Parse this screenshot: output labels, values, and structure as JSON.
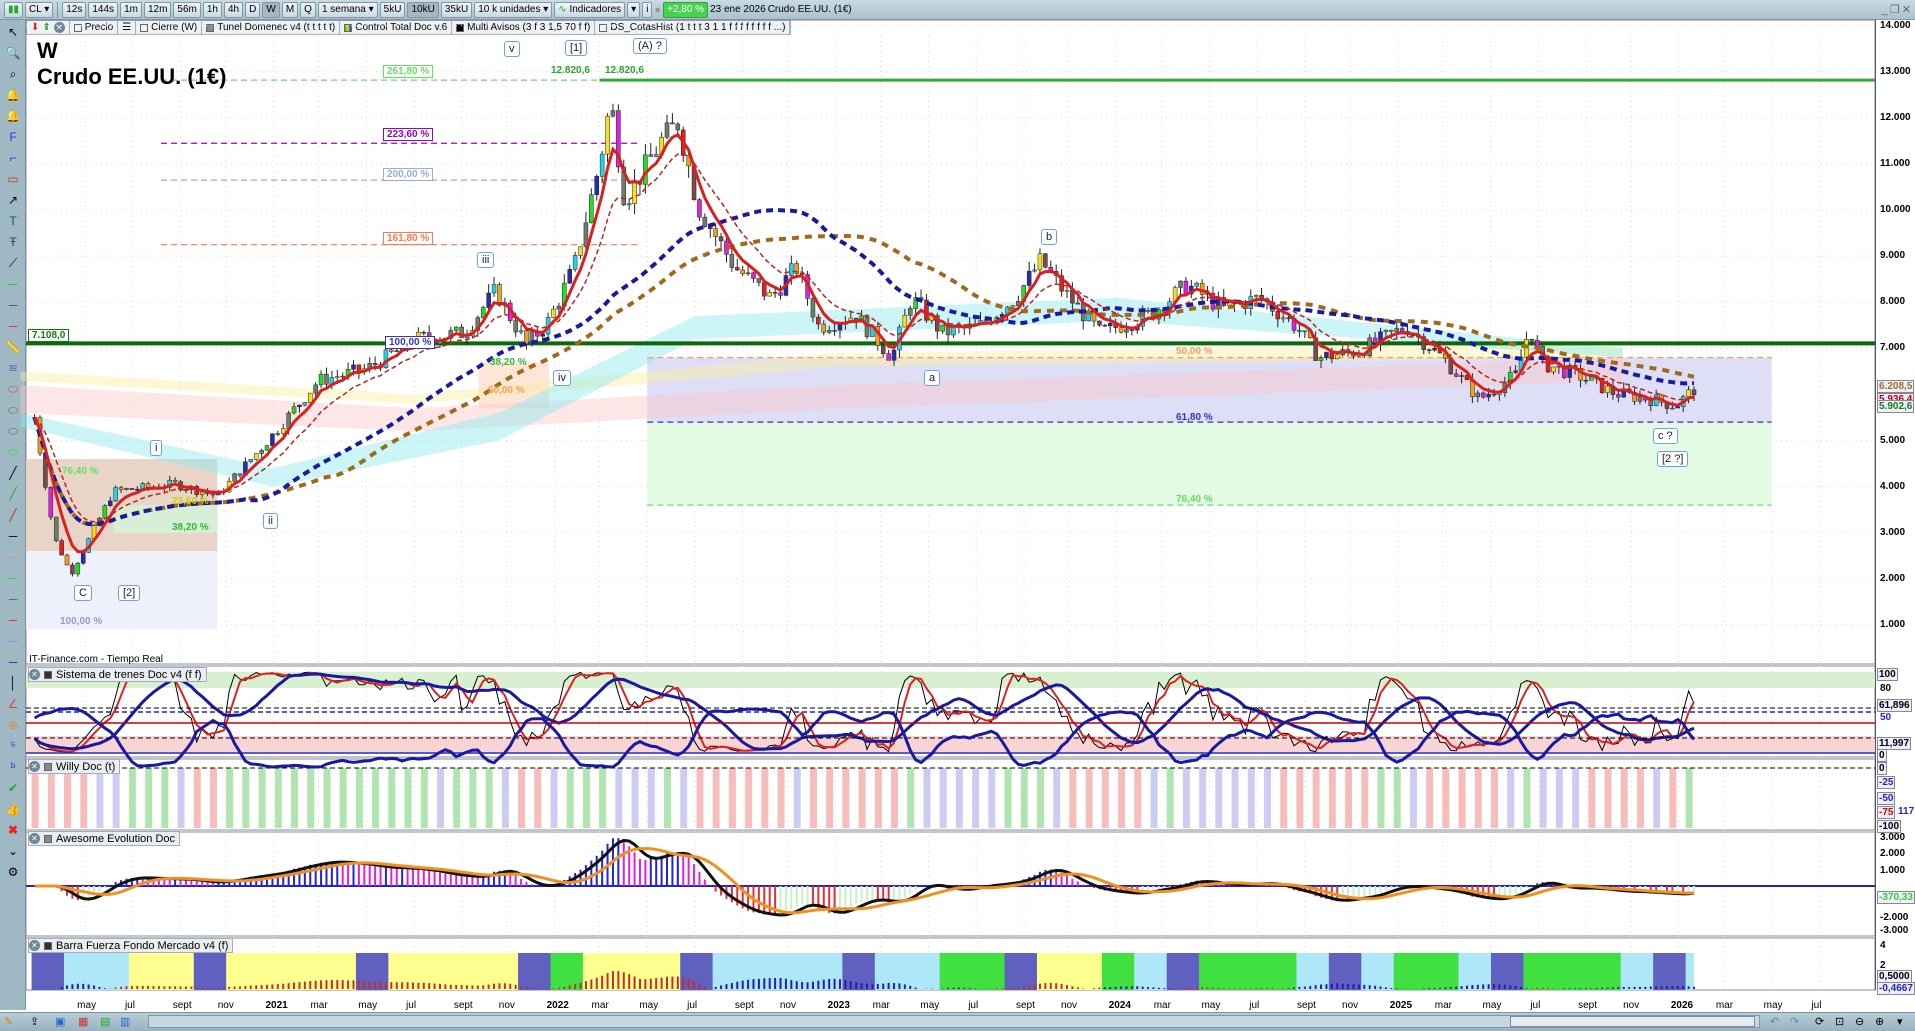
{
  "toolbar": {
    "symbol": "CL",
    "intervals": [
      "12s",
      "144s",
      "1m",
      "12m",
      "56m",
      "1h",
      "4h",
      "D",
      "W",
      "M",
      "Q"
    ],
    "active_interval": "W",
    "period": "1 semana",
    "units": [
      "5kU",
      "10kU",
      "35kU"
    ],
    "active_unit": "10kU",
    "units_select": "10 k unidades",
    "indicators_label": "Indicadores",
    "change": "+2,80 %",
    "date": "23 ene 2026",
    "instrument": "Crudo EE.UU. (1€)"
  },
  "legend": [
    {
      "label": "Precio"
    },
    {
      "label": "Cierre (W)"
    },
    {
      "label": "Tunel Domenec v4 (t t t t t)"
    },
    {
      "label": "Control Total Doc v.6"
    },
    {
      "label": "Multi Avisos (3 f 3 1,5 70 f f)"
    },
    {
      "label": "DS_CotasHist (1 t t t 3 1 1 f f f f f f f f ...)"
    }
  ],
  "chart": {
    "timeframe": "W",
    "title": "Crudo EE.UU. (1€)",
    "source": "IT-Finance.com - Tiempo Real",
    "hline_label": "7.108,0",
    "top_labels": [
      "12.820,6",
      "12.820,6"
    ],
    "price_ticks": [
      "14.000",
      "13.000",
      "12.000",
      "11.000",
      "10.000",
      "9.000",
      "8.000",
      "7.000",
      "5.000",
      "4.000",
      "3.000",
      "2.000",
      "1.000"
    ],
    "price_tick_values": [
      14000,
      13000,
      12000,
      11000,
      10000,
      9000,
      8000,
      7000,
      5000,
      4000,
      3000,
      2000,
      1000
    ],
    "last_labels": [
      {
        "text": "6.208,5",
        "color": "#a0701a"
      },
      {
        "text": "5.936,4",
        "color": "#c00000"
      },
      {
        "text": "5.902,6",
        "color": "#108010"
      }
    ],
    "fib_labels": [
      "261,80 %",
      "223,60 %",
      "200,00 %",
      "161,80 %",
      "100,00 %",
      "38,20 %",
      "50,00 %",
      "76,40 %",
      "23,60 %",
      "38,20 %",
      "100,00 %",
      "50,00 %",
      "61,80 %",
      "76,40 %"
    ],
    "waves": [
      "v",
      "[1]",
      "(A) ?",
      "iii",
      "i",
      "ii",
      "iv",
      "C",
      "[2]",
      "a",
      "b",
      "c ?",
      "[2 ?]"
    ]
  },
  "chart_data": {
    "type": "candlestick",
    "x_unit": "decimal year",
    "y_unit": "price",
    "key_points": [
      [
        2020.15,
        5500
      ],
      [
        2020.22,
        2900
      ],
      [
        2020.28,
        2100
      ],
      [
        2020.43,
        3900
      ],
      [
        2020.65,
        4060
      ],
      [
        2020.8,
        3800
      ],
      [
        2020.98,
        5000
      ],
      [
        2021.16,
        6300
      ],
      [
        2021.33,
        6550
      ],
      [
        2021.51,
        7200
      ],
      [
        2021.68,
        7340
      ],
      [
        2021.79,
        8250
      ],
      [
        2021.9,
        7070
      ],
      [
        2021.98,
        7600
      ],
      [
        2022.07,
        8770
      ],
      [
        2022.16,
        11000
      ],
      [
        2022.2,
        12400
      ],
      [
        2022.25,
        10200
      ],
      [
        2022.38,
        11500
      ],
      [
        2022.44,
        11900
      ],
      [
        2022.51,
        10080
      ],
      [
        2022.64,
        8770
      ],
      [
        2022.77,
        8100
      ],
      [
        2022.86,
        8770
      ],
      [
        2022.94,
        7470
      ],
      [
        2023.07,
        7730
      ],
      [
        2023.2,
        6800
      ],
      [
        2023.27,
        8100
      ],
      [
        2023.38,
        7340
      ],
      [
        2023.51,
        7470
      ],
      [
        2023.64,
        8100
      ],
      [
        2023.73,
        8900
      ],
      [
        2023.81,
        8250
      ],
      [
        2023.94,
        7340
      ],
      [
        2024.12,
        7730
      ],
      [
        2024.25,
        8380
      ],
      [
        2024.38,
        7860
      ],
      [
        2024.51,
        8100
      ],
      [
        2024.64,
        7470
      ],
      [
        2024.72,
        6800
      ],
      [
        2024.86,
        6940
      ],
      [
        2025.03,
        7470
      ],
      [
        2025.16,
        6800
      ],
      [
        2025.29,
        5900
      ],
      [
        2025.42,
        6420
      ],
      [
        2025.47,
        7470
      ],
      [
        2025.51,
        6680
      ],
      [
        2025.64,
        6420
      ],
      [
        2025.77,
        6030
      ],
      [
        2025.9,
        5900
      ],
      [
        2025.99,
        5760
      ],
      [
        2026.06,
        6150
      ]
    ],
    "ylim": [
      0,
      14000
    ],
    "xlim": [
      2020.1,
      2026.6
    ],
    "levels": {
      "resistance": 7108.0,
      "high": 12820.6
    }
  },
  "panels": [
    {
      "title": "Sistema de trenes Doc v4 (f f)",
      "ticks": [
        "100",
        "80",
        "61,896",
        "50",
        "11,997",
        "0"
      ]
    },
    {
      "title": "Willy Doc (t)",
      "ticks": [
        "0",
        "-25",
        "-50",
        "-75",
        "-100"
      ],
      "value": "117"
    },
    {
      "title": "Awesome Evolution Doc",
      "ticks": [
        "3.000",
        "2.000",
        "1.000",
        "-370,33",
        "-2.000",
        "-3.000"
      ]
    },
    {
      "title": "Barra Fuerza Fondo Mercado v4 (f)",
      "ticks": [
        "4",
        "2",
        "0,5000",
        "-0,4667"
      ]
    }
  ],
  "time_axis": [
    "may",
    "jul",
    "sept",
    "nov",
    "2021",
    "mar",
    "may",
    "jul",
    "sept",
    "nov",
    "2022",
    "mar",
    "may",
    "jul",
    "sept",
    "nov",
    "2023",
    "mar",
    "may",
    "jul",
    "sept",
    "nov",
    "2024",
    "mar",
    "may",
    "jul",
    "sept",
    "nov",
    "2025",
    "mar",
    "may",
    "jul",
    "sept",
    "nov",
    "2026",
    "mar",
    "may",
    "jul"
  ],
  "time_axis_values": [
    2020.33,
    2020.5,
    2020.67,
    2020.83,
    2021,
    2021.16,
    2021.33,
    2021.5,
    2021.67,
    2021.83,
    2022,
    2022.16,
    2022.33,
    2022.5,
    2022.67,
    2022.83,
    2023,
    2023.16,
    2023.33,
    2023.5,
    2023.67,
    2023.83,
    2024,
    2024.16,
    2024.33,
    2024.5,
    2024.67,
    2024.83,
    2025,
    2025.16,
    2025.33,
    2025.5,
    2025.67,
    2025.83,
    2026,
    2026.16,
    2026.33,
    2026.5
  ]
}
